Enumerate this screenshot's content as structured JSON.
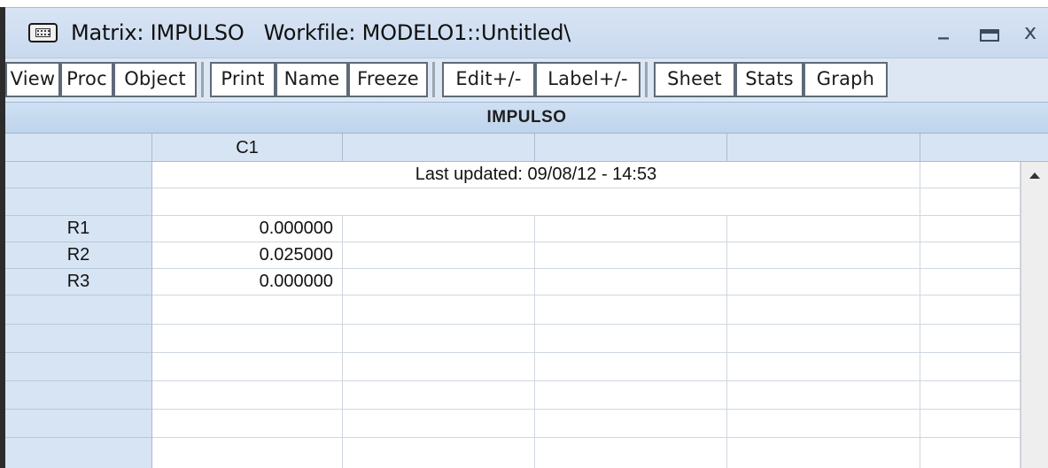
{
  "window": {
    "title_matrix": "Matrix: IMPULSO",
    "title_workfile": "Workfile: MODELO1::Untitled\\",
    "controls": {
      "minimize": "_",
      "close": "x"
    }
  },
  "toolbar": {
    "buttons": [
      "View",
      "Proc",
      "Object",
      "Print",
      "Name",
      "Freeze",
      "Edit+/-",
      "Label+/-",
      "Sheet",
      "Stats",
      "Graph"
    ]
  },
  "matrix": {
    "name": "IMPULSO",
    "columns": [
      "C1",
      "",
      "",
      "",
      ""
    ],
    "last_updated": "Last updated: 09/08/12 - 14:53",
    "rows": [
      {
        "label": "R1",
        "value": "0.000000"
      },
      {
        "label": "R2",
        "value": "0.025000"
      },
      {
        "label": "R3",
        "value": "0.000000"
      }
    ]
  },
  "colors": {
    "titlebar": "#d0dff1",
    "header_bg": "#d7e4f3",
    "grid_line": "#cfd7e0"
  }
}
